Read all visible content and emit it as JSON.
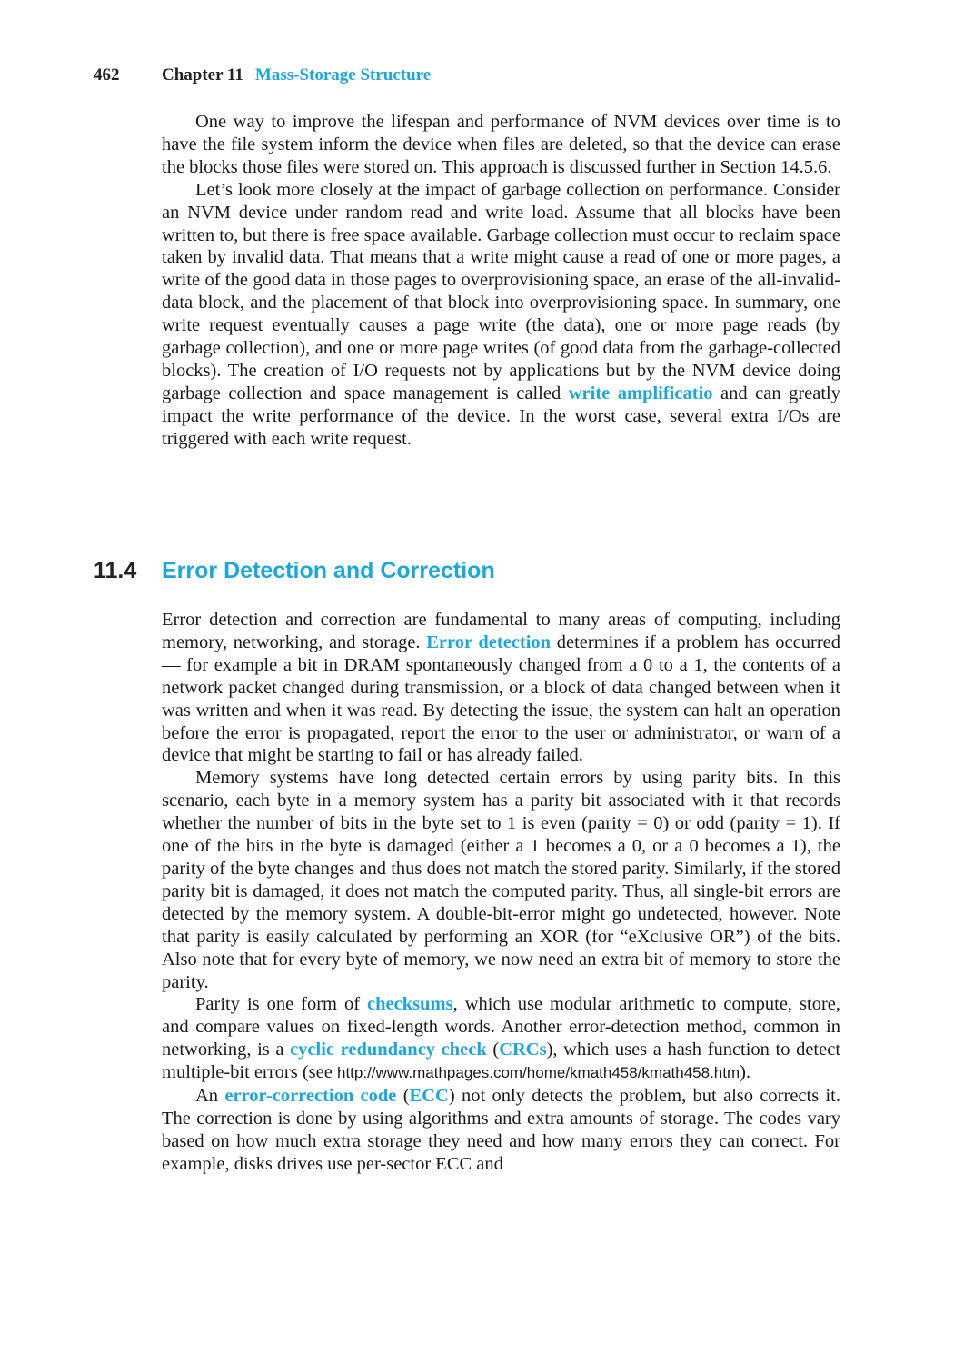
{
  "header": {
    "page_number": "462",
    "chapter": "Chapter 11",
    "chapter_title": "Mass-Storage Structure"
  },
  "colors": {
    "accent": "#1aa7e0",
    "text": "#1a1a1a"
  },
  "top_paragraphs": {
    "p1": "One way to improve the lifespan and performance of NVM devices over time is to have the file system inform the device when files are deleted, so that the device can erase the blocks those files were stored on. This approach is discussed further in Section 14.5.6.",
    "p2_before": "Let’s look more closely at the impact of garbage collection on performance. Consider an NVM device under random read and write load. Assume that all blocks have been written to, but there is free space available. Garbage collection must occur to reclaim space taken by invalid data. That means that a write might cause a read of one or more pages, a write of the good data in those pages to overprovisioning space, an erase of the all-invalid-data block, and the placement of that block into overprovisioning space. In summary, one write request eventually causes a page write (the data), one or more page reads (by garbage collection), and one or more page writes (of good data from the garbage-collected blocks). The creation of I/O requests not by applications but by the NVM device doing garbage collection and space management is called",
    "p2_term": "write amplificatio",
    "p2_after": " and can greatly impact the write performance of the device. In the worst case, several extra I/Os are triggered with each write request."
  },
  "section": {
    "number": "11.4",
    "title": "Error Detection and Correction"
  },
  "section_paragraphs": {
    "s1_before": "Error detection and correction are fundamental to many areas of computing, including memory, networking, and storage.",
    "s1_term": "Error detection",
    "s1_after": "determines if a problem has occurred — for example a bit in DRAM spontaneously changed from a 0 to a 1, the contents of a network packet changed during transmission, or a block of data changed between when it was written and when it was read. By detecting the issue, the system can halt an operation before the error is propagated, report the error to the user or administrator, or warn of a device that might be starting to fail or has already failed.",
    "s2": "Memory systems have long detected certain errors by using parity bits. In this scenario, each byte in a memory system has a parity bit associated with it that records whether the number of bits in the byte set to 1 is even (parity = 0) or odd (parity = 1). If one of the bits in the byte is damaged (either a 1 becomes a 0, or a 0 becomes a 1), the parity of the byte changes and thus does not match the stored parity. Similarly, if the stored parity bit is damaged, it does not match the computed parity. Thus, all single-bit errors are detected by the memory system. A double-bit-error might go undetected, however. Note that parity is easily calculated by performing an XOR (for “eXclusive OR”) of the bits. Also note that for every byte of memory, we now need an extra bit of memory to store the parity.",
    "s3_a": "Parity is one form of",
    "s3_term1": "checksums",
    "s3_b": ", which use modular arithmetic to compute, store, and compare values on fixed-length words. Another error-detection method, common in networking, is a",
    "s3_term2": "cyclic redundancy check",
    "s3_c": " (",
    "s3_term3": "CRCs",
    "s3_d": "), which uses a hash function to detect multiple-bit errors (see ",
    "s3_url": "http://www.mathpages.com/home/kmath458/kmath458.htm",
    "s3_e": ").",
    "s4_a": "An",
    "s4_term1": "error-correction code",
    "s4_b": " (",
    "s4_term2": "ECC",
    "s4_c": ") not only detects the problem, but also corrects it. The correction is done by using algorithms and extra amounts of storage. The codes vary based on how much extra storage they need and how many errors they can correct. For example, disks drives use per-sector ECC and"
  }
}
